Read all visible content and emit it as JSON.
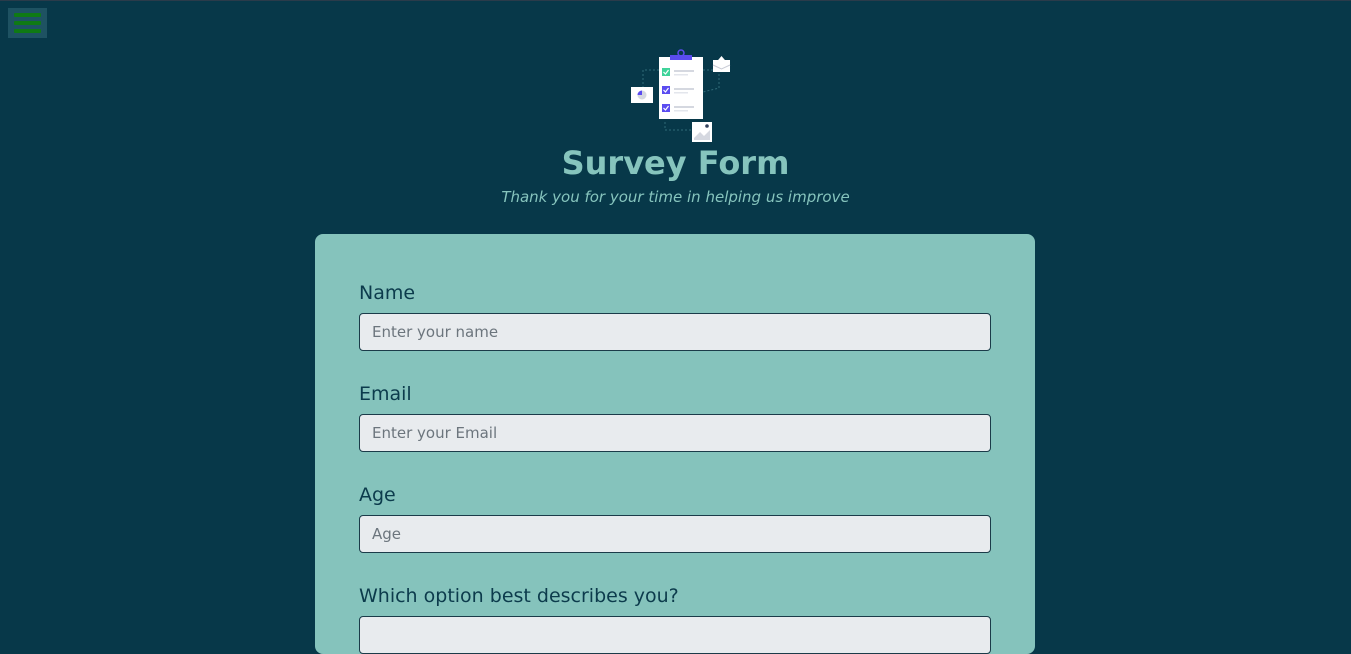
{
  "header": {
    "title": "Survey Form",
    "subtitle": "Thank you for your time in helping us improve",
    "illustration_icon": "survey-checklist-illustration"
  },
  "menu": {
    "icon": "hamburger-menu-icon",
    "color": "#0f7a14"
  },
  "form": {
    "fields": [
      {
        "label": "Name",
        "placeholder": "Enter your name"
      },
      {
        "label": "Email",
        "placeholder": "Enter your Email"
      },
      {
        "label": "Age",
        "placeholder": "Age"
      }
    ],
    "role_question": {
      "label": "Which option best describes you?"
    }
  },
  "colors": {
    "background": "#073849",
    "card": "#85c3bc",
    "title": "#86c4bd",
    "label": "#0c3b4c",
    "input_bg": "#e8ebee",
    "illustration_accent": "#5b4cf0",
    "illustration_check": "#3fd39a"
  }
}
